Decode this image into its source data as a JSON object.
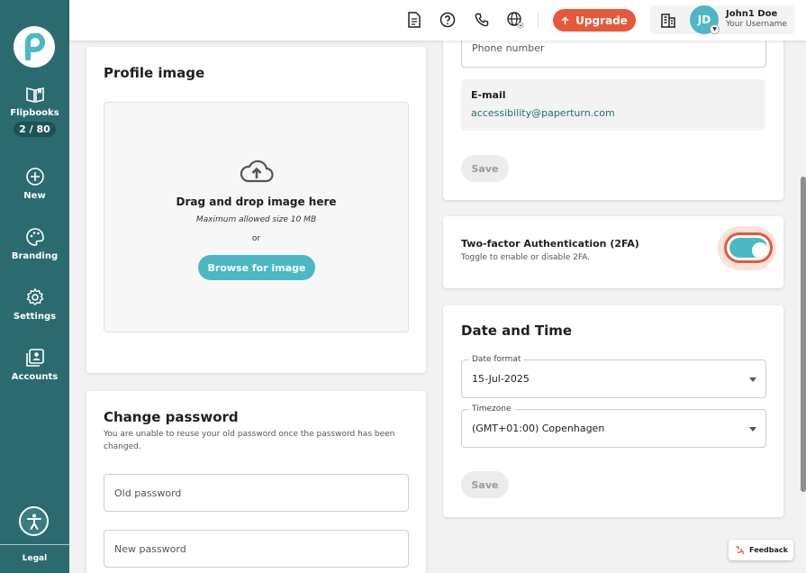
{
  "sidebar": {
    "logo_letter": "P",
    "items": [
      {
        "label": "Flipbooks",
        "icon": "book-open-icon",
        "badge": "2 / 80"
      },
      {
        "label": "New",
        "icon": "plus-circle-icon"
      },
      {
        "label": "Branding",
        "icon": "palette-icon"
      },
      {
        "label": "Settings",
        "icon": "gear-icon"
      },
      {
        "label": "Accounts",
        "icon": "accounts-icon"
      }
    ],
    "accessibility_icon": "accessibility-icon",
    "legal_label": "Legal"
  },
  "header": {
    "icons": [
      "document-icon",
      "help-icon",
      "phone-icon",
      "globe-icon"
    ],
    "upgrade_label": "Upgrade",
    "building_icon": "building-icon",
    "user": {
      "initials": "JD",
      "name": "John1 Doe",
      "username": "Your Username"
    }
  },
  "profile_image": {
    "title": "Profile image",
    "drop_title": "Drag and drop image here",
    "max_size": "Maximum allowed size 10 MB",
    "or": "or",
    "browse_label": "Browse for image"
  },
  "change_password": {
    "title": "Change password",
    "note": "You are unable to reuse your old password once the password has been changed.",
    "old_placeholder": "Old password",
    "new_placeholder": "New password"
  },
  "contact": {
    "phone_placeholder": "Phone number",
    "email_label": "E-mail",
    "email_value": "accessibility@paperturn.com",
    "save_label": "Save"
  },
  "two_factor": {
    "title": "Two-factor Authentication (2FA)",
    "subtitle": "Toggle to enable or disable 2FA.",
    "enabled": true
  },
  "date_time": {
    "title": "Date and Time",
    "date_format_label": "Date format",
    "date_format_value": "15-Jul-2025",
    "timezone_label": "Timezone",
    "timezone_value": "(GMT+01:00) Copenhagen",
    "save_label": "Save"
  },
  "feedback_label": "Feedback",
  "colors": {
    "sidebar": "#2b6b70",
    "accent": "#4bb8c4",
    "upgrade": "#e3593a"
  }
}
